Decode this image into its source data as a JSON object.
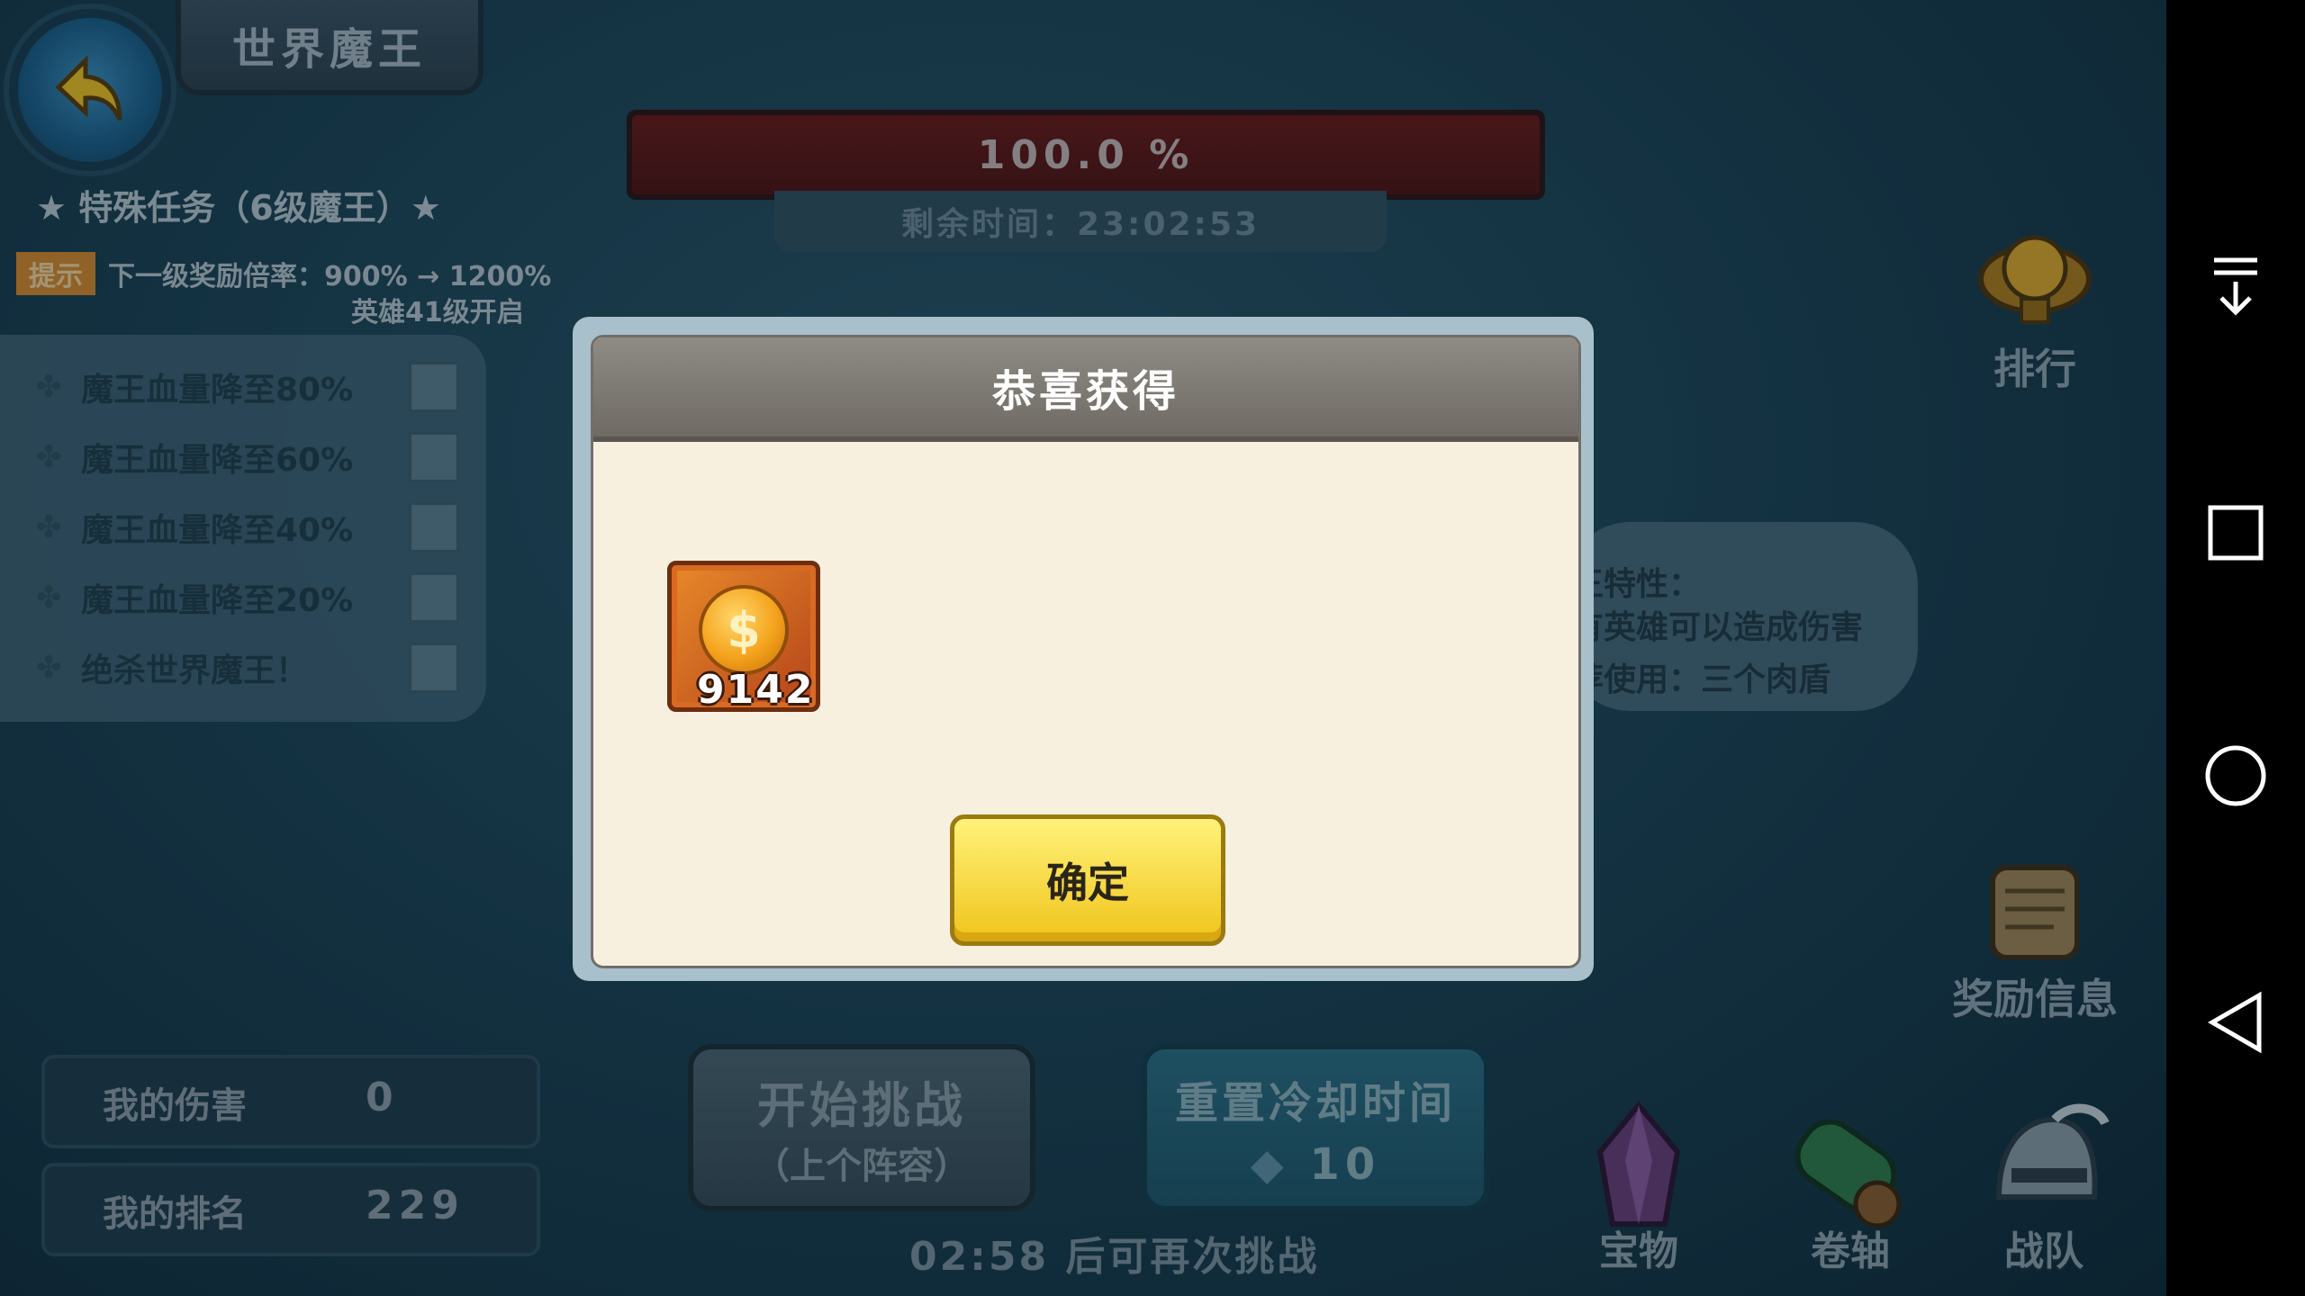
{
  "header": {
    "title": "世界魔王",
    "mission": "★ 特殊任务（6级魔王）★",
    "hint_badge": "提示",
    "hint_text": "下一级奖励倍率：900% → 1200%",
    "hint_sub": "英雄41级开启"
  },
  "tasks": [
    {
      "label": "魔王血量降至80%"
    },
    {
      "label": "魔王血量降至60%"
    },
    {
      "label": "魔王血量降至40%"
    },
    {
      "label": "魔王血量降至20%"
    },
    {
      "label": "绝杀世界魔王！"
    }
  ],
  "boss": {
    "hp_text": "100.0 %",
    "hp_fraction": 1.0,
    "remaining_time": "剩余时间：23:02:53",
    "trait_line1": "王特性：",
    "trait_line2": "有英雄可以造成伤害",
    "trait_line3": "荐使用：三个肉盾"
  },
  "side": {
    "rank": "排行",
    "reward_info": "奖励信息"
  },
  "stats": {
    "damage_label": "我的伤害",
    "damage_value": "0",
    "rank_label": "我的排名",
    "rank_value": "229"
  },
  "actions": {
    "start_main": "开始挑战",
    "start_sub": "（上个阵容）",
    "reset_main": "重置冷却时间",
    "reset_cost": "10",
    "cooldown": "02:58 后可再次挑战"
  },
  "bottom": {
    "treasure": "宝物",
    "scroll": "卷轴",
    "team": "战队"
  },
  "dialog": {
    "title": "恭喜获得",
    "reward_icon": "gold-coin",
    "reward_count": "9142",
    "confirm": "确定"
  },
  "colors": {
    "confirm_button": "#f5d432",
    "hp_bar": "#6b1515",
    "hint_badge": "#d9892a"
  }
}
